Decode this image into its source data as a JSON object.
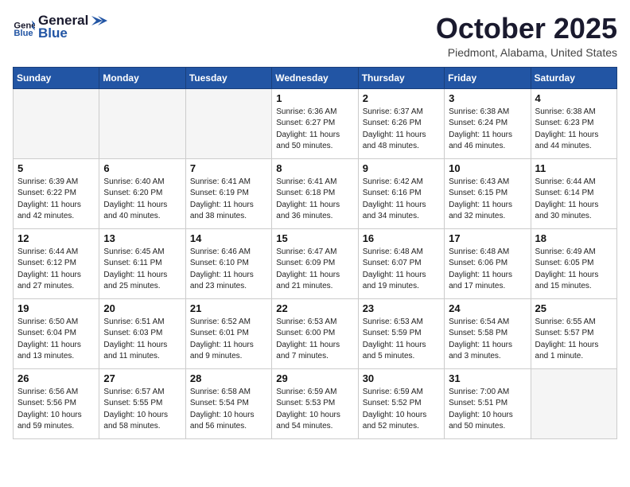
{
  "header": {
    "logo_line1": "General",
    "logo_line2": "Blue",
    "month": "October 2025",
    "location": "Piedmont, Alabama, United States"
  },
  "weekdays": [
    "Sunday",
    "Monday",
    "Tuesday",
    "Wednesday",
    "Thursday",
    "Friday",
    "Saturday"
  ],
  "weeks": [
    [
      {
        "day": "",
        "info": ""
      },
      {
        "day": "",
        "info": ""
      },
      {
        "day": "",
        "info": ""
      },
      {
        "day": "1",
        "info": "Sunrise: 6:36 AM\nSunset: 6:27 PM\nDaylight: 11 hours\nand 50 minutes."
      },
      {
        "day": "2",
        "info": "Sunrise: 6:37 AM\nSunset: 6:26 PM\nDaylight: 11 hours\nand 48 minutes."
      },
      {
        "day": "3",
        "info": "Sunrise: 6:38 AM\nSunset: 6:24 PM\nDaylight: 11 hours\nand 46 minutes."
      },
      {
        "day": "4",
        "info": "Sunrise: 6:38 AM\nSunset: 6:23 PM\nDaylight: 11 hours\nand 44 minutes."
      }
    ],
    [
      {
        "day": "5",
        "info": "Sunrise: 6:39 AM\nSunset: 6:22 PM\nDaylight: 11 hours\nand 42 minutes."
      },
      {
        "day": "6",
        "info": "Sunrise: 6:40 AM\nSunset: 6:20 PM\nDaylight: 11 hours\nand 40 minutes."
      },
      {
        "day": "7",
        "info": "Sunrise: 6:41 AM\nSunset: 6:19 PM\nDaylight: 11 hours\nand 38 minutes."
      },
      {
        "day": "8",
        "info": "Sunrise: 6:41 AM\nSunset: 6:18 PM\nDaylight: 11 hours\nand 36 minutes."
      },
      {
        "day": "9",
        "info": "Sunrise: 6:42 AM\nSunset: 6:16 PM\nDaylight: 11 hours\nand 34 minutes."
      },
      {
        "day": "10",
        "info": "Sunrise: 6:43 AM\nSunset: 6:15 PM\nDaylight: 11 hours\nand 32 minutes."
      },
      {
        "day": "11",
        "info": "Sunrise: 6:44 AM\nSunset: 6:14 PM\nDaylight: 11 hours\nand 30 minutes."
      }
    ],
    [
      {
        "day": "12",
        "info": "Sunrise: 6:44 AM\nSunset: 6:12 PM\nDaylight: 11 hours\nand 27 minutes."
      },
      {
        "day": "13",
        "info": "Sunrise: 6:45 AM\nSunset: 6:11 PM\nDaylight: 11 hours\nand 25 minutes."
      },
      {
        "day": "14",
        "info": "Sunrise: 6:46 AM\nSunset: 6:10 PM\nDaylight: 11 hours\nand 23 minutes."
      },
      {
        "day": "15",
        "info": "Sunrise: 6:47 AM\nSunset: 6:09 PM\nDaylight: 11 hours\nand 21 minutes."
      },
      {
        "day": "16",
        "info": "Sunrise: 6:48 AM\nSunset: 6:07 PM\nDaylight: 11 hours\nand 19 minutes."
      },
      {
        "day": "17",
        "info": "Sunrise: 6:48 AM\nSunset: 6:06 PM\nDaylight: 11 hours\nand 17 minutes."
      },
      {
        "day": "18",
        "info": "Sunrise: 6:49 AM\nSunset: 6:05 PM\nDaylight: 11 hours\nand 15 minutes."
      }
    ],
    [
      {
        "day": "19",
        "info": "Sunrise: 6:50 AM\nSunset: 6:04 PM\nDaylight: 11 hours\nand 13 minutes."
      },
      {
        "day": "20",
        "info": "Sunrise: 6:51 AM\nSunset: 6:03 PM\nDaylight: 11 hours\nand 11 minutes."
      },
      {
        "day": "21",
        "info": "Sunrise: 6:52 AM\nSunset: 6:01 PM\nDaylight: 11 hours\nand 9 minutes."
      },
      {
        "day": "22",
        "info": "Sunrise: 6:53 AM\nSunset: 6:00 PM\nDaylight: 11 hours\nand 7 minutes."
      },
      {
        "day": "23",
        "info": "Sunrise: 6:53 AM\nSunset: 5:59 PM\nDaylight: 11 hours\nand 5 minutes."
      },
      {
        "day": "24",
        "info": "Sunrise: 6:54 AM\nSunset: 5:58 PM\nDaylight: 11 hours\nand 3 minutes."
      },
      {
        "day": "25",
        "info": "Sunrise: 6:55 AM\nSunset: 5:57 PM\nDaylight: 11 hours\nand 1 minute."
      }
    ],
    [
      {
        "day": "26",
        "info": "Sunrise: 6:56 AM\nSunset: 5:56 PM\nDaylight: 10 hours\nand 59 minutes."
      },
      {
        "day": "27",
        "info": "Sunrise: 6:57 AM\nSunset: 5:55 PM\nDaylight: 10 hours\nand 58 minutes."
      },
      {
        "day": "28",
        "info": "Sunrise: 6:58 AM\nSunset: 5:54 PM\nDaylight: 10 hours\nand 56 minutes."
      },
      {
        "day": "29",
        "info": "Sunrise: 6:59 AM\nSunset: 5:53 PM\nDaylight: 10 hours\nand 54 minutes."
      },
      {
        "day": "30",
        "info": "Sunrise: 6:59 AM\nSunset: 5:52 PM\nDaylight: 10 hours\nand 52 minutes."
      },
      {
        "day": "31",
        "info": "Sunrise: 7:00 AM\nSunset: 5:51 PM\nDaylight: 10 hours\nand 50 minutes."
      },
      {
        "day": "",
        "info": ""
      }
    ]
  ]
}
